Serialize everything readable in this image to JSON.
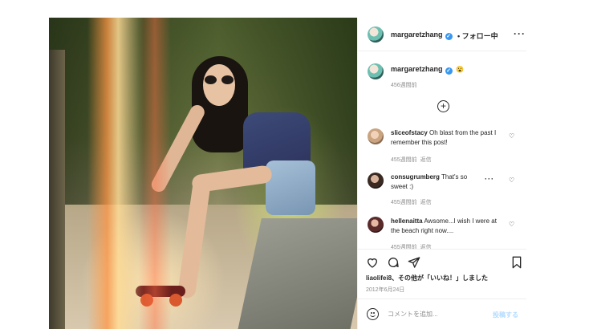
{
  "post": {
    "username": "margaretzhang",
    "follow_label": "• フォロー中",
    "more_icon": "ellipsis-icon",
    "photo_alt": "woman in sunglasses sitting on a stone ledge with a skateboard"
  },
  "caption": {
    "username": "margaretzhang",
    "emoji": "😮",
    "time": "456週間前"
  },
  "comments": [
    {
      "username": "sliceofstacy",
      "text": "Oh blast from the past I remember this post!",
      "time": "455週間前",
      "reply": "返信"
    },
    {
      "username": "consugrumberg",
      "text": "That's so sweet :)",
      "time": "455週間前",
      "reply": "返信"
    },
    {
      "username": "hellenaitta",
      "text": "Awsome...I wish I were at the beach right now....",
      "time": "455週間前",
      "reply": "返信"
    }
  ],
  "likes": {
    "first_user": "liaolifei8",
    "suffix": "、その他が「いいね！」しました"
  },
  "date": "2012年6月24日",
  "comment_box": {
    "placeholder": "コメントを追加...",
    "post_label": "投稿する"
  },
  "colors": {
    "verified": "#3897f0",
    "post_button": "#b3dbff",
    "muted": "#8e8e8e"
  }
}
